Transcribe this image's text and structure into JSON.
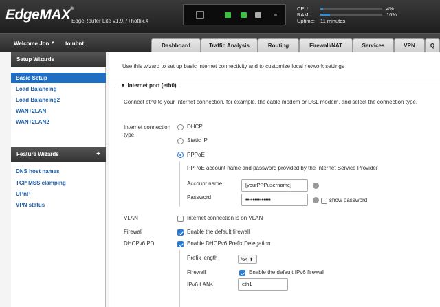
{
  "header": {
    "logo": "EdgeMAX",
    "logo_mark": "®",
    "version": "EdgeRouter Lite v1.9.7+hotfix.4",
    "stats": {
      "cpu_label": "CPU:",
      "cpu_value": "4%",
      "cpu_percent": 4,
      "ram_label": "RAM:",
      "ram_value": "16%",
      "ram_percent": 16,
      "uptime_label": "Uptime:",
      "uptime_value": "11 minutes"
    }
  },
  "nav": {
    "welcome": "Welcome Jon",
    "to_ubnt": "to ubnt",
    "tabs": [
      "Dashboard",
      "Traffic Analysis",
      "Routing",
      "Firewall/NAT",
      "Services",
      "VPN",
      "Q"
    ]
  },
  "sidebar": {
    "setup_header": "Setup Wizards",
    "setup_items": [
      "Basic Setup",
      "Load Balancing",
      "Load Balancing2",
      "WAN+2LAN",
      "WAN+2LAN2"
    ],
    "feature_header": "Feature Wizards",
    "feature_plus": "+",
    "feature_items": [
      "DNS host names",
      "TCP MSS clamping",
      "UPnP",
      "VPN status"
    ]
  },
  "main": {
    "intro": "Use this wizard to set up basic Internet connectivity and to customize local network settings",
    "legend": "Internet port (eth0)",
    "legend_caret": "▾",
    "description": "Connect eth0 to your Internet connection, for example, the cable modem or DSL modem, and select the connection type.",
    "conn_type_label": "Internet connection type",
    "options": {
      "dhcp": "DHCP",
      "static": "Static IP",
      "pppoe": "PPPoE"
    },
    "pppoe_desc": "PPPoE account name and password provided by the Internet Service Provider",
    "account_label": "Account name",
    "account_value": "[yourPPPusername]",
    "password_label": "Password",
    "password_value": "••••••••••••••",
    "show_password": "show password",
    "info_glyph": "i",
    "vlan_label": "VLAN",
    "vlan_text": "Internet connection is on VLAN",
    "firewall_label": "Firewall",
    "firewall_text": "Enable the default firewall",
    "dhcpv6_label": "DHCPv6 PD",
    "dhcpv6_text": "Enable DHCPv6 Prefix Delegation",
    "prefix_label": "Prefix length",
    "prefix_value": "/64 ⬍",
    "ipv6_fw_label": "Firewall",
    "ipv6_fw_text": "Enable the default IPv6 firewall",
    "ipv6_lans_label": "IPv6 LANs",
    "ipv6_lans_value": "eth1"
  },
  "colors": {
    "accent": "#1f6ec2",
    "link": "#1f5fa8",
    "port_active": "#3fbf3f"
  }
}
